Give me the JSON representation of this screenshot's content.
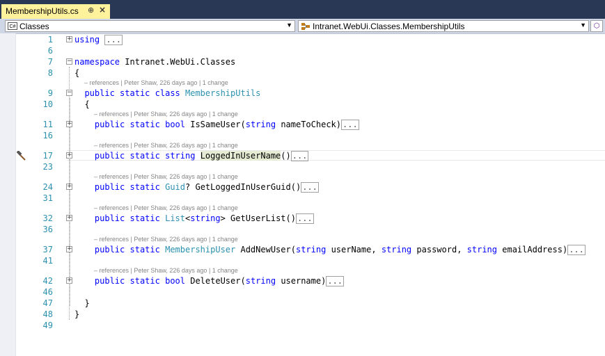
{
  "tab": {
    "title": "MembershipUtils.cs",
    "pin_glyph": "⊕",
    "close_glyph": "×"
  },
  "navbar": {
    "types_dropdown": {
      "value": "Classes",
      "icon": "csharp-file-icon",
      "icon_text": "C#"
    },
    "members_dropdown": {
      "value": "Intranet.WebUi.Classes.MembershipUtils",
      "icon": "class-icon"
    }
  },
  "colors": {
    "keyword": "#0000ff",
    "type": "#2b91af",
    "line_number": "#2b91af",
    "tab_active": "#fff29d",
    "titlebar": "#293955"
  },
  "code_lens": "– references | Peter Shaw, 226 days ago | 1 change",
  "lines": [
    {
      "num": "1",
      "using": "using",
      "collapsed": "..."
    },
    {
      "num": "6"
    },
    {
      "num": "7",
      "kw": "namespace",
      "name": "Intranet.WebUi.Classes"
    },
    {
      "num": "8",
      "text": "{"
    },
    {
      "num": "9",
      "kw1": "public",
      "kw2": "static",
      "kw3": "class",
      "type": "MembershipUtils"
    },
    {
      "num": "10",
      "text": "{"
    },
    {
      "num": "11",
      "kw1": "public",
      "kw2": "static",
      "kw3": "bool",
      "method": "IsSameUser",
      "param_kw": "string",
      "param": "nameToCheck",
      "collapsed": "..."
    },
    {
      "num": "16"
    },
    {
      "num": "17",
      "kw1": "public",
      "kw2": "static",
      "kw3": "string",
      "method": "LoggedInUserName",
      "collapsed": "..."
    },
    {
      "num": "23"
    },
    {
      "num": "24",
      "kw1": "public",
      "kw2": "static",
      "type": "Guid",
      "nullable": "?",
      "method": "GetLoggedInUserGuid",
      "collapsed": "..."
    },
    {
      "num": "31"
    },
    {
      "num": "32",
      "kw1": "public",
      "kw2": "static",
      "type": "List",
      "generic_kw": "string",
      "method": "GetUserList",
      "collapsed": "..."
    },
    {
      "num": "36"
    },
    {
      "num": "37",
      "kw1": "public",
      "kw2": "static",
      "type": "MembershipUser",
      "method": "AddNewUser",
      "p1_kw": "string",
      "p1": "userName",
      "p2_kw": "string",
      "p2": "password",
      "p3_kw": "string",
      "p3": "emailAddress",
      "collapsed": "..."
    },
    {
      "num": "41"
    },
    {
      "num": "42",
      "kw1": "public",
      "kw2": "static",
      "kw3": "bool",
      "method": "DeleteUser",
      "param_kw": "string",
      "param": "username",
      "collapsed": "..."
    },
    {
      "num": "46"
    },
    {
      "num": "47",
      "text": "}"
    },
    {
      "num": "48",
      "text": "}"
    },
    {
      "num": "49"
    }
  ]
}
